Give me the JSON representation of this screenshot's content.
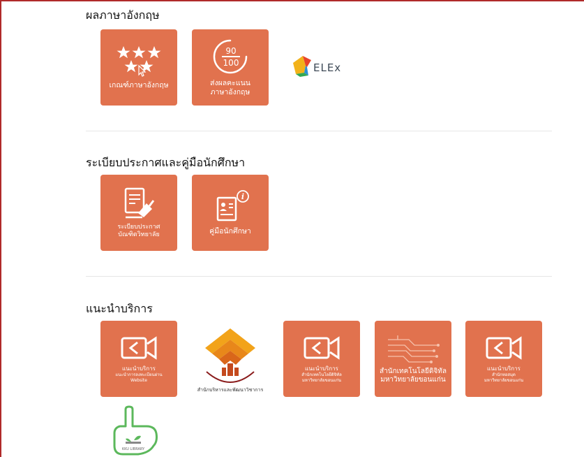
{
  "sections": {
    "english": {
      "title": "ผลภาษาอังกฤษ",
      "tiles": [
        {
          "label": "เกณฑ์ภาษาอังกฤษ"
        },
        {
          "label_line1": "ส่งผลคะแนน",
          "label_line2": "ภาษาอังกฤษ",
          "icon_top": "90",
          "icon_bottom": "100"
        }
      ],
      "celex_logo": "ELEx",
      "celex_logo_suffix": "x"
    },
    "regulations": {
      "title": "ระเบียบประกาศและคู่มือนักศึกษา",
      "tiles": [
        {
          "label_line1": "ระเบียบประกาศ",
          "label_line2": "บัณฑิตวิทยาลัย"
        },
        {
          "label": "คู่มือนักศึกษา"
        }
      ]
    },
    "services": {
      "title": "แนะนำบริการ",
      "tiles": [
        {
          "label": "แนะนำบริการ",
          "sub1": "แนะนำการลงทะเบียนผ่าน",
          "sub2": "Website"
        },
        {
          "logo_text": "สำนักบริหารและพัฒนาวิชาการ"
        },
        {
          "label": "แนะนำบริการ",
          "sub1": "สำนักเทคโนโลยีดิจิทัล",
          "sub2": "มหาวิทยาลัยขอนแก่น"
        },
        {
          "label_line1": "สำนักเทคโนโลยีดิจิทัล",
          "label_line2": "มหาวิทยาลัยขอนแก่น"
        },
        {
          "label": "แนะนำบริการ",
          "sub1": "สำนักหอสมุด",
          "sub2": "มหาวิทยาลัยขอนแก่น"
        },
        {
          "logo_text": "KKU LIBRARY"
        }
      ]
    }
  },
  "colors": {
    "tile": "#e1724e",
    "frame": "#b02a2a"
  },
  "icons": [
    "stars-icon",
    "score-icon",
    "celex-logo",
    "document-icon",
    "manual-icon",
    "video-icon",
    "academic-logo",
    "circuit-icon",
    "library-logo"
  ]
}
